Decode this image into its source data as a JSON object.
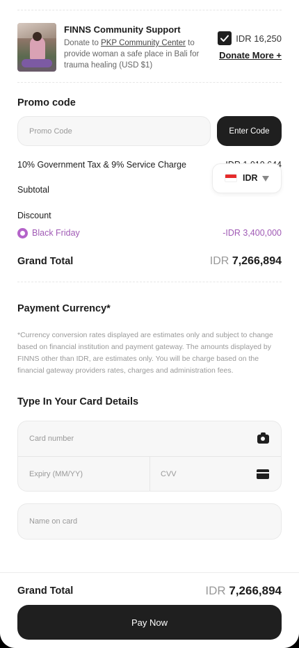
{
  "donation": {
    "title": "FINNS Community Support",
    "desc_prefix": "Donate to ",
    "desc_link": "PKP Community Center",
    "desc_suffix": " to provide woman a safe place in Bali for trauma healing (USD $1)",
    "checked": true,
    "amount": "IDR 16,250",
    "donate_more": "Donate More +"
  },
  "promo": {
    "heading": "Promo code",
    "placeholder": "Promo Code",
    "button": "Enter Code"
  },
  "summary": {
    "tax_label": "10% Government Tax & 9% Service Charge",
    "tax_value": "IDR 1,010,644",
    "subtotal_label": "Subtotal",
    "subtotal_value": "",
    "discount_label": "Discount",
    "discount_name": "Black Friday",
    "discount_value": "-IDR 3,400,000",
    "grand_label": "Grand Total",
    "grand_currency": "IDR",
    "grand_amount": "7,266,894"
  },
  "currency_select": {
    "code": "IDR",
    "flag": "indonesia-flag"
  },
  "payment_currency": {
    "heading": "Payment Currency*",
    "disclaimer": "*Currency conversion rates displayed are estimates only and subject to change based on financial institution and payment gateway. The amounts displayed by FINNS other than IDR, are estimates only. You will be charge based on the financial gateway providers rates, charges and administration fees."
  },
  "card": {
    "heading": "Type In Your Card Details",
    "number_placeholder": "Card number",
    "expiry_placeholder": "Expiry (MM/YY)",
    "cvv_placeholder": "CVV",
    "name_placeholder": "Name on card"
  },
  "footer": {
    "grand_label": "Grand Total",
    "grand_currency": "IDR",
    "grand_amount": "7,266,894",
    "pay_button": "Pay Now"
  },
  "colors": {
    "accent_dark": "#1f1f1f",
    "promo_purple": "#a05ab5"
  }
}
